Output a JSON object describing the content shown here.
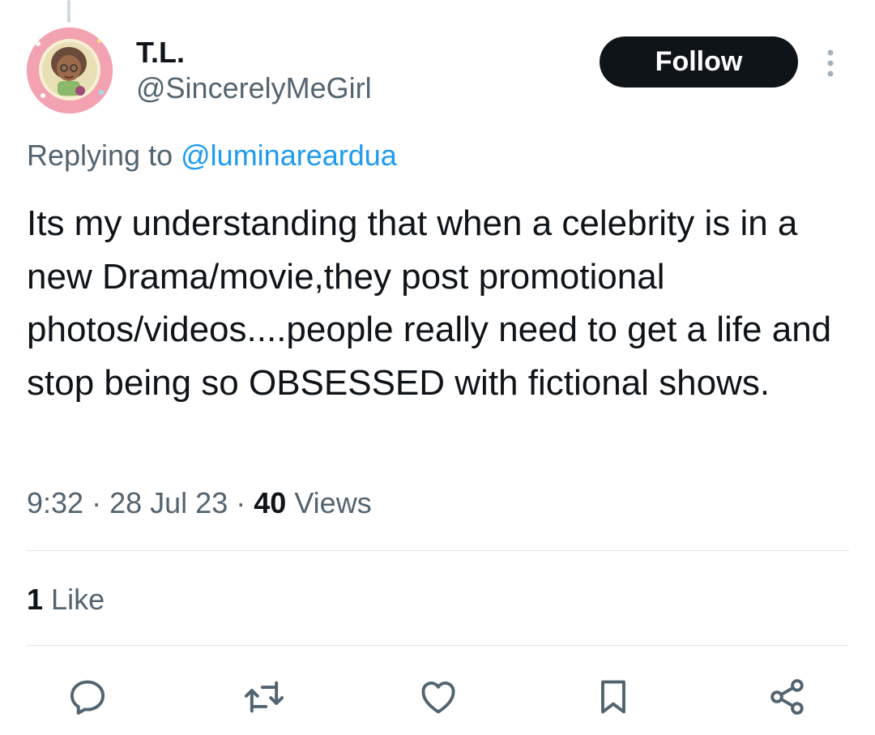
{
  "author": {
    "display_name": "T.L.",
    "handle": "@SincerelyMeGirl"
  },
  "follow_button": {
    "label": "Follow"
  },
  "reply_context": {
    "prefix": "Replying to",
    "mention": "@luminareardua"
  },
  "tweet": {
    "text": "Its my understanding that when a celebrity is in a new Drama/movie,they post promotional photos/videos....people really need to get a life and stop being so OBSESSED with fictional shows."
  },
  "meta": {
    "time": "9:32",
    "separator": "·",
    "date": "28 Jul 23",
    "views_count": "40",
    "views_label": "Views"
  },
  "engagement": {
    "likes_count": "1",
    "likes_label": "Like"
  },
  "actions": [
    "reply-icon",
    "retweet-icon",
    "like-icon",
    "bookmark-icon",
    "share-icon"
  ],
  "colors": {
    "link": "#1d9bf0",
    "secondary_text": "#536471",
    "primary_text": "#0f1419",
    "follow_bg": "#0f1419"
  }
}
